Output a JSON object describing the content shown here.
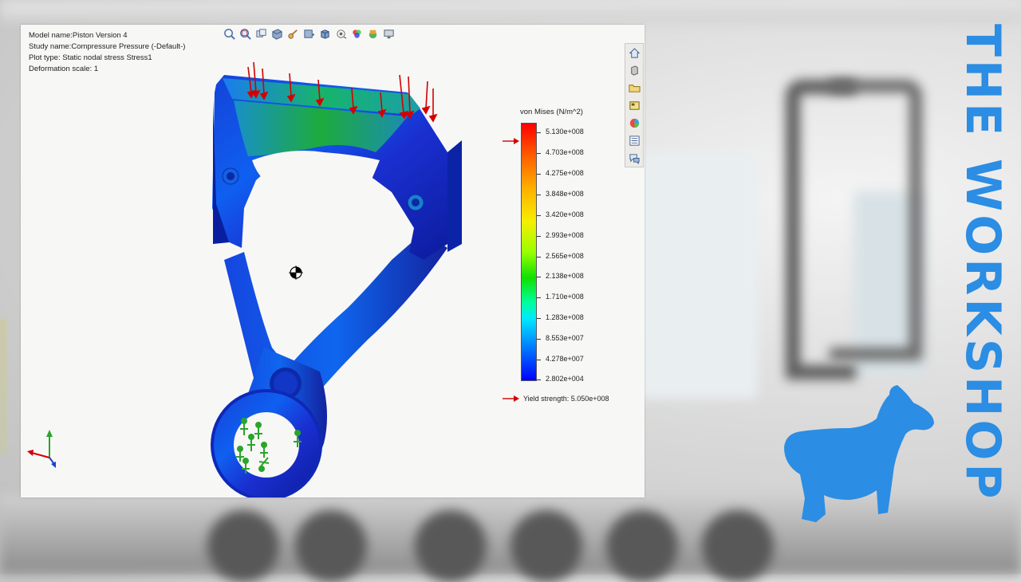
{
  "info": {
    "model_name": "Model name:Piston Version 4",
    "study_name": "Study name:Compressure Pressure (-Default-)",
    "plot_type": "Plot type: Static nodal stress Stress1",
    "deformation": "Deformation scale: 1"
  },
  "toolbar": {
    "icons": [
      "zoom-to-fit-icon",
      "zoom-to-area-icon",
      "previous-view-icon",
      "section-view-icon",
      "view-orientation-icon",
      "display-style-icon",
      "hide-show-icon",
      "edit-appearance-icon",
      "apply-scene-icon",
      "view-settings-icon"
    ]
  },
  "side_toolbar": {
    "icons": [
      "home-icon",
      "parts-icon",
      "file-explorer-icon",
      "view-palette-icon",
      "appearances-icon",
      "custom-properties-icon",
      "simulation-advisor-icon"
    ]
  },
  "legend": {
    "title": "von Mises (N/m^2)",
    "ticks": [
      "5.130e+008",
      "4.703e+008",
      "4.275e+008",
      "3.848e+008",
      "3.420e+008",
      "2.993e+008",
      "2.565e+008",
      "2.138e+008",
      "1.710e+008",
      "1.283e+008",
      "8.553e+007",
      "4.278e+007",
      "2.802e+004"
    ],
    "yield_label": "Yield strength: 5.050e+008",
    "max_value": 513000000,
    "min_value": 28020,
    "yield_value": 505000000,
    "colors": {
      "max": "#ff0000",
      "min": "#0000ff",
      "arrow": "#d40000"
    }
  },
  "brand": {
    "name": "THE WORKSHOP",
    "color": "#2b8de3"
  }
}
